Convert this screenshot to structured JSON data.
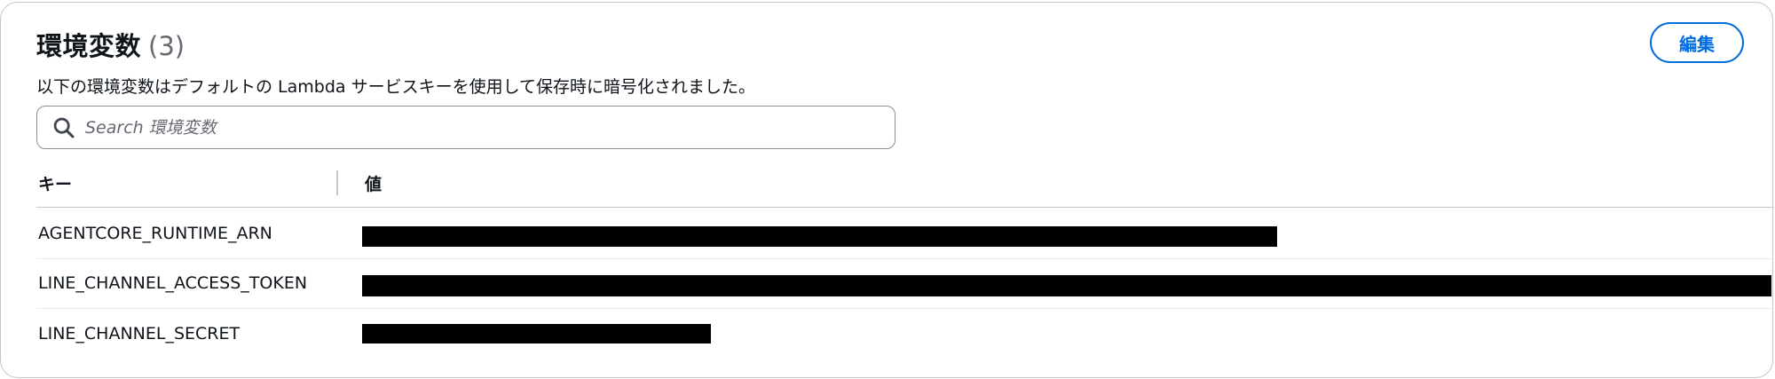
{
  "panel": {
    "title": "環境変数",
    "count": "(3)",
    "description": "以下の環境変数はデフォルトの Lambda サービスキーを使用して保存時に暗号化されました。",
    "edit_label": "編集"
  },
  "search": {
    "placeholder": "Search 環境変数",
    "value": ""
  },
  "table": {
    "columns": [
      "キー",
      "値"
    ],
    "rows": [
      {
        "key": "AGENTCORE_RUNTIME_ARN",
        "value_redacted": true
      },
      {
        "key": "LINE_CHANNEL_ACCESS_TOKEN",
        "value_redacted": true
      },
      {
        "key": "LINE_CHANNEL_SECRET",
        "value_redacted": true
      }
    ]
  },
  "colors": {
    "accent": "#006ce0",
    "text": "#0f141a",
    "muted": "#656871",
    "border": "#c6c6cd",
    "redaction": "#000000"
  },
  "icons": {
    "search": "search-icon"
  }
}
